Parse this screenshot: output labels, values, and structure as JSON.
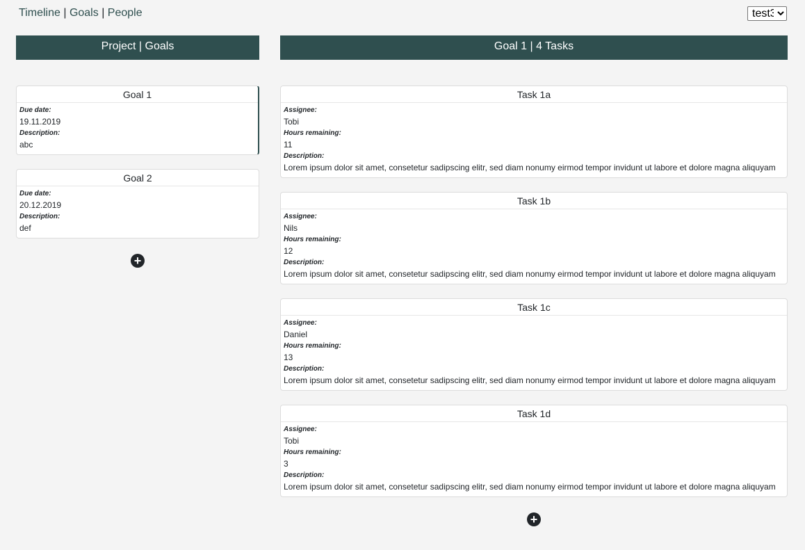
{
  "nav": {
    "timeline": "Timeline",
    "goals": "Goals",
    "people": "People",
    "separator": "|"
  },
  "project_select": {
    "selected": "test3"
  },
  "left_header": {
    "title": "Project | Goals"
  },
  "right_header": {
    "title": "Goal 1 | 4 Tasks"
  },
  "goal_labels": {
    "due": "Due date:",
    "desc": "Description:"
  },
  "goals": [
    {
      "name": "Goal 1",
      "due": "19.11.2019",
      "description": "abc"
    },
    {
      "name": "Goal 2",
      "due": "20.12.2019",
      "description": "def"
    }
  ],
  "task_labels": {
    "assignee": "Assignee:",
    "hours": "Hours remaining:",
    "desc": "Description:"
  },
  "tasks": [
    {
      "name": "Task 1a",
      "assignee": "Tobi",
      "hours": "11",
      "description": "Lorem ipsum dolor sit amet, consetetur sadipscing elitr, sed diam nonumy eirmod tempor invidunt ut labore et dolore magna aliquyam"
    },
    {
      "name": "Task 1b",
      "assignee": "Nils",
      "hours": "12",
      "description": "Lorem ipsum dolor sit amet, consetetur sadipscing elitr, sed diam nonumy eirmod tempor invidunt ut labore et dolore magna aliquyam"
    },
    {
      "name": "Task 1c",
      "assignee": "Daniel",
      "hours": "13",
      "description": "Lorem ipsum dolor sit amet, consetetur sadipscing elitr, sed diam nonumy eirmod tempor invidunt ut labore et dolore magna aliquyam"
    },
    {
      "name": "Task 1d",
      "assignee": "Tobi",
      "hours": "3",
      "description": "Lorem ipsum dolor sit amet, consetetur sadipscing elitr, sed diam nonumy eirmod tempor invidunt ut labore et dolore magna aliquyam"
    }
  ],
  "add_icon": "plus-circle-icon",
  "add_symbol": "+",
  "colors": {
    "header_bg": "#2f4f4f",
    "background": "#f4f4f4",
    "add_button": "#212529"
  }
}
